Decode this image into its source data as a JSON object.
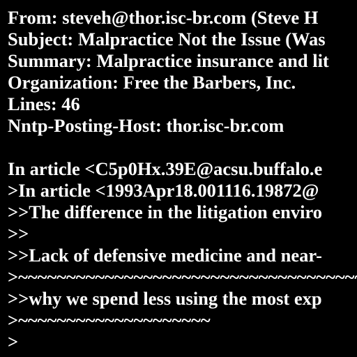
{
  "message": {
    "from": "From: steveh@thor.isc-br.com (Steve H",
    "subject": "Subject: Malpractice Not the Issue (Was",
    "summary": "Summary: Malpractice insurance and lit",
    "organization": "Organization: Free the Barbers, Inc.",
    "lines": "Lines: 46",
    "nntp_host": "Nntp-Posting-Host: thor.isc-br.com",
    "blank": "",
    "body": [
      "In article <C5p0Hx.39E@acsu.buffalo.e",
      ">In article <1993Apr18.001116.19872@",
      ">>The difference in the litigation enviro",
      ">>",
      ">>Lack of defensive medicine and near-",
      ">~~~~~~~~~~~~~~~~~~~~~~~~~~~~~~~~~~~~~~~~~~~~~~~",
      ">>why we spend less using the most exp",
      ">~~~~~~~~~~~~~~~~~~~~",
      ">"
    ]
  },
  "colors": {
    "background": "#000000",
    "text": "#ffffff"
  }
}
